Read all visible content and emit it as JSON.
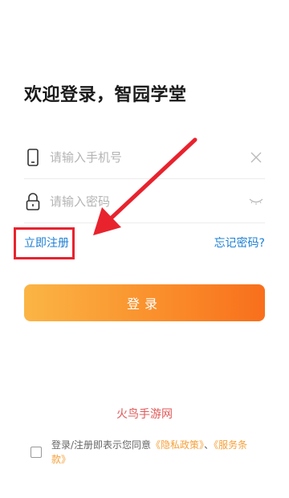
{
  "header": {
    "title": "欢迎登录，智园学堂"
  },
  "form": {
    "phone_placeholder": "请输入手机号",
    "password_placeholder": "请输入密码",
    "register_label": "立即注册",
    "forgot_label": "忘记密码?",
    "login_label": "登录"
  },
  "watermark": "火鸟手游网",
  "agreement": {
    "prefix": "登录/注册即表示您同意",
    "privacy": "《隐私政策》",
    "separator": "、",
    "service": "《服务条款》"
  },
  "colors": {
    "accent_link": "#1e80d6",
    "button_start": "#fbb545",
    "button_end": "#f86f1c",
    "highlight": "#e8232e"
  }
}
